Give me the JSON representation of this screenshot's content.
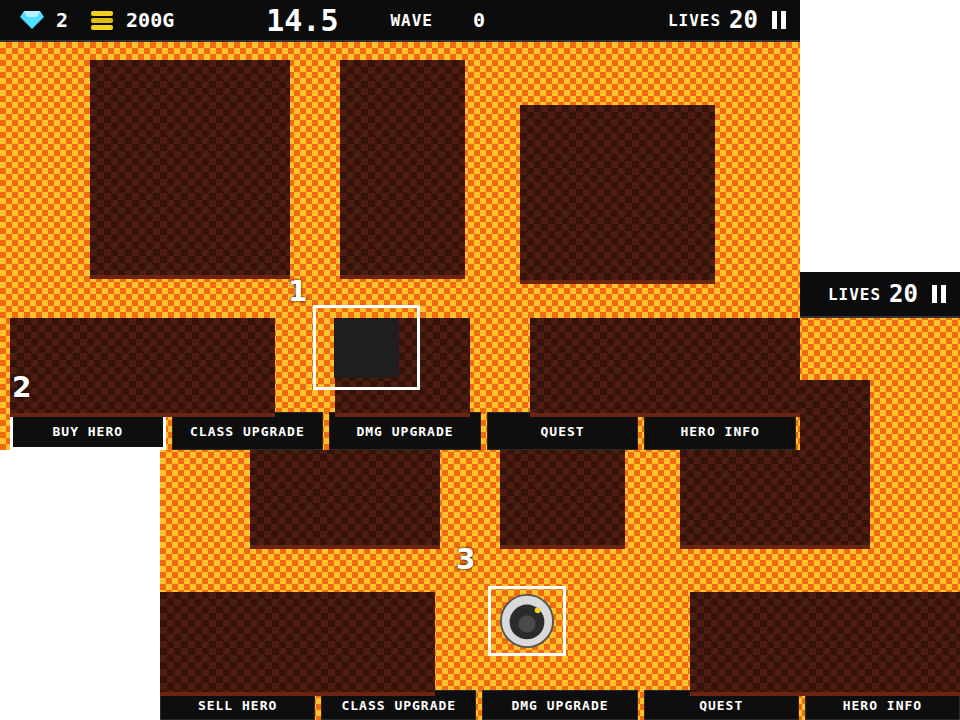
{
  "screens": [
    {
      "hud": {
        "gems": "2",
        "gold": "200G",
        "timer": "14.5",
        "wave_label": "WAVE",
        "wave": "0",
        "lives_label": "LIVES",
        "lives": "20"
      },
      "markers": [
        {
          "label": "1",
          "kind": "tile"
        },
        {
          "label": "2",
          "kind": "hint"
        }
      ],
      "buttons": [
        {
          "label": "BUY HERO",
          "selected": true
        },
        {
          "label": "CLASS UPGRADE",
          "selected": false
        },
        {
          "label": "DMG UPGRADE",
          "selected": false
        },
        {
          "label": "QUEST",
          "selected": false
        },
        {
          "label": "HERO INFO",
          "selected": false
        }
      ]
    },
    {
      "hud": {
        "lives_label": "LIVES",
        "lives": "20"
      },
      "markers": [
        {
          "label": "3",
          "kind": "hero"
        }
      ],
      "buttons": [
        {
          "label": "SELL HERO",
          "selected": false
        },
        {
          "label": "CLASS UPGRADE",
          "selected": false
        },
        {
          "label": "DMG UPGRADE",
          "selected": false
        },
        {
          "label": "QUEST",
          "selected": false
        },
        {
          "label": "HERO INFO",
          "selected": false
        }
      ]
    }
  ]
}
